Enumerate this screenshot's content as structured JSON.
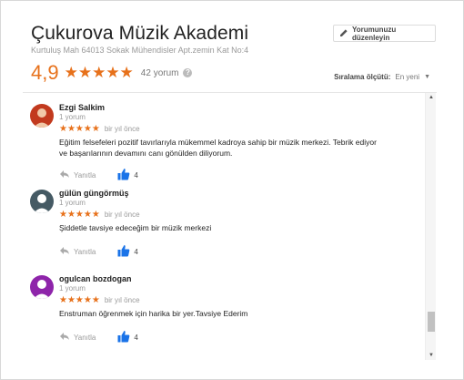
{
  "header": {
    "title": "Çukurova Müzik Akademi",
    "address": "Kurtuluş Mah 64013 Sokak Mühendisler Apt.zemin Kat No:4",
    "edit_button_label": "Yorumunuzu düzenleyin"
  },
  "summary": {
    "rating": "4,9",
    "stars": "★★★★★",
    "review_count": "42 yorum",
    "info_symbol": "?"
  },
  "sort": {
    "label": "Sıralama ölçütü:",
    "value": "En yeni",
    "caret": "▼"
  },
  "reviews": [
    {
      "name": "Ezgi Salkim",
      "subtitle": "1 yorum",
      "stars": "★★★★★",
      "time": "bir yıl önce",
      "text": "Eğitim felsefeleri pozitif tavırlarıyla mükemmel kadroya sahip bir müzik merkezi. Tebrik ediyor ve başarılarının devamını canı gönülden diliyorum.",
      "reply_label": "Yanıtla",
      "likes": "4",
      "avatar_color": "#c23a1e"
    },
    {
      "name": "gülün güngörmüş",
      "subtitle": "1 yorum",
      "stars": "★★★★★",
      "time": "bir yıl önce",
      "text": "Şiddetle tavsiye edeceğim bir müzik merkezi",
      "reply_label": "Yanıtla",
      "likes": "4",
      "avatar_color": "#455a64"
    },
    {
      "name": "ogulcan bozdogan",
      "subtitle": "1 yorum",
      "stars": "★★★★★",
      "time": "bir yıl önce",
      "text": "Enstruman öğrenmek için harika bir yer.Tavsiye Ederim",
      "reply_label": "Yanıtla",
      "likes": "4",
      "avatar_color": "#8e24aa"
    }
  ],
  "scrollbar": {
    "up": "▲",
    "down": "▼"
  },
  "colors": {
    "accent": "#e7711b",
    "like_blue": "#1a73e8"
  }
}
